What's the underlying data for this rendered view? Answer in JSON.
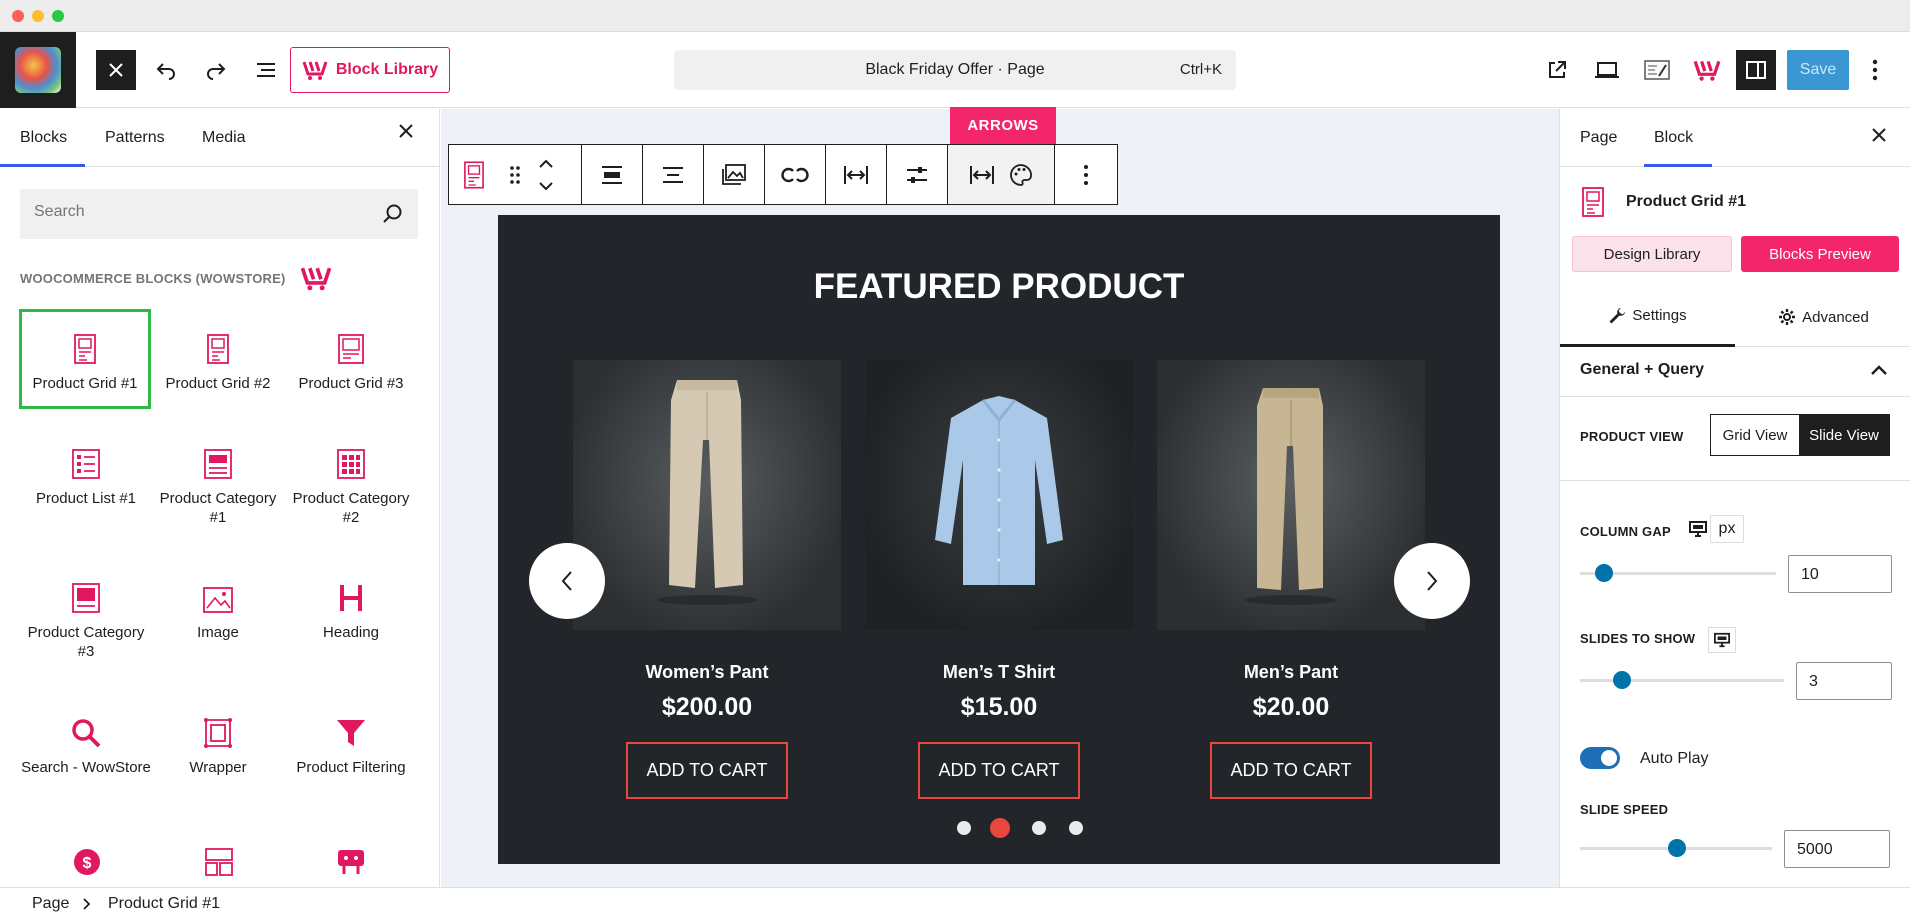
{
  "topbar": {
    "block_library_label": "Block Library",
    "command_title": "Black Friday Offer · Page",
    "command_shortcut": "Ctrl+K",
    "save_label": "Save"
  },
  "left_panel": {
    "tabs": [
      "Blocks",
      "Patterns",
      "Media"
    ],
    "search_placeholder": "Search",
    "category_title": "WOOCOMMERCE BLOCKS (WOWSTORE)",
    "blocks": [
      {
        "label": "Product Grid #1",
        "icon": "product-grid-icon"
      },
      {
        "label": "Product Grid #2",
        "icon": "product-grid-icon"
      },
      {
        "label": "Product Grid #3",
        "icon": "product-grid-icon"
      },
      {
        "label": "Product List #1",
        "icon": "product-list-icon"
      },
      {
        "label": "Product Category #1",
        "icon": "product-category-icon"
      },
      {
        "label": "Product Category #2",
        "icon": "product-category-grid-icon"
      },
      {
        "label": "Product Category #3",
        "icon": "product-category-icon"
      },
      {
        "label": "Image",
        "icon": "image-icon"
      },
      {
        "label": "Heading",
        "icon": "heading-icon"
      },
      {
        "label": "Search - WowStore",
        "icon": "search-icon"
      },
      {
        "label": "Wrapper",
        "icon": "wrapper-icon"
      },
      {
        "label": "Product Filtering",
        "icon": "filter-icon"
      }
    ]
  },
  "canvas": {
    "arrows_tag": "ARROWS",
    "section_title": "FEATURED PRODUCT",
    "products": [
      {
        "name": "Women’s Pant",
        "price": "$200.00",
        "button": "ADD TO CART"
      },
      {
        "name": "Men’s T Shirt",
        "price": "$15.00",
        "button": "ADD TO CART"
      },
      {
        "name": "Men’s Pant",
        "price": "$20.00",
        "button": "ADD TO CART"
      }
    ],
    "active_dot": 2,
    "dot_count": 4
  },
  "right_panel": {
    "tabs": [
      "Page",
      "Block"
    ],
    "block_name": "Product Grid #1",
    "design_library": "Design Library",
    "blocks_preview": "Blocks Preview",
    "settings_tab": "Settings",
    "advanced_tab": "Advanced",
    "section_title": "General + Query",
    "product_view_label": "PRODUCT VIEW",
    "grid_view": "Grid View",
    "slide_view": "Slide View",
    "column_gap_label": "COLUMN GAP",
    "column_gap_unit": "px",
    "column_gap_value": "10",
    "slides_to_show_label": "SLIDES TO SHOW",
    "slides_to_show_value": "3",
    "auto_play_label": "Auto Play",
    "auto_play_on": true,
    "slide_speed_label": "SLIDE SPEED",
    "slide_speed_value": "5000"
  },
  "breadcrumb": {
    "root": "Page",
    "current": "Product Grid #1"
  },
  "colors": {
    "brand_pink": "#e0185f",
    "accent_blue": "#3858e9",
    "save_blue": "#3a97d4",
    "cart_border": "#e8463f"
  }
}
